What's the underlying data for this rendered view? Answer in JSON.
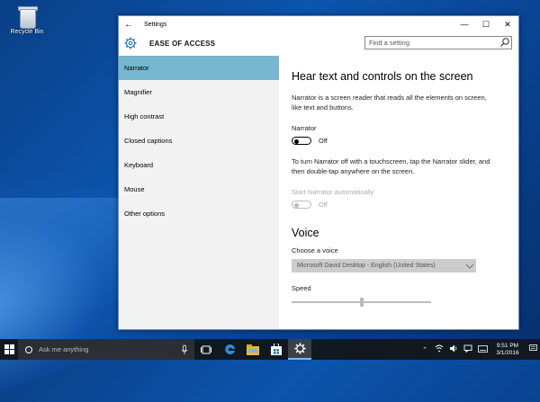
{
  "desktop": {
    "recycle_bin_label": "Recycle Bin"
  },
  "window": {
    "title": "Settings",
    "minimize": "—",
    "maximize": "☐",
    "close": "✕",
    "section_title": "EASE OF ACCESS",
    "search_placeholder": "Find a setting"
  },
  "sidebar": {
    "items": [
      {
        "label": "Narrator",
        "active": true
      },
      {
        "label": "Magnifier"
      },
      {
        "label": "High contrast"
      },
      {
        "label": "Closed captions"
      },
      {
        "label": "Keyboard"
      },
      {
        "label": "Mouse"
      },
      {
        "label": "Other options"
      }
    ]
  },
  "main": {
    "heading": "Hear text and controls on the screen",
    "description": "Narrator is a screen reader that reads all the elements on screen, like text and buttons.",
    "narrator_label": "Narrator",
    "narrator_state": "Off",
    "touch_info": "To turn Narrator off with a touchscreen, tap the Narrator slider, and then double-tap anywhere on the screen.",
    "auto_label": "Start Narrator automatically",
    "auto_state": "Off",
    "voice_heading": "Voice",
    "choose_voice_label": "Choose a voice",
    "voice_selected": "Microsoft David Desktop - English (United States)",
    "speed_label": "Speed",
    "speed_level": 0.5
  },
  "taskbar": {
    "search_placeholder": "Ask me anything",
    "time": "9:51 PM",
    "date": "3/1/2016"
  }
}
